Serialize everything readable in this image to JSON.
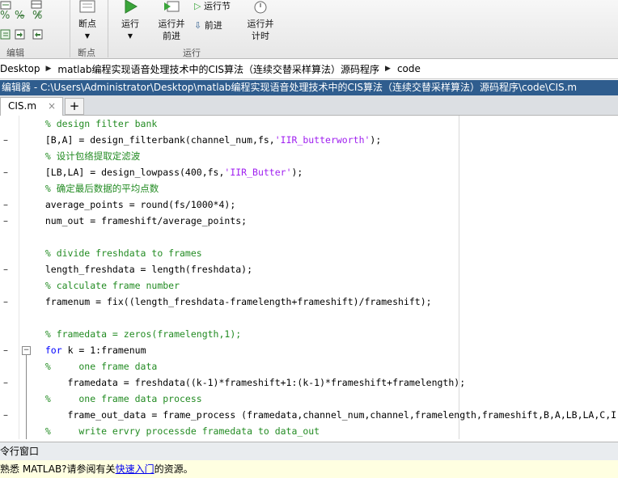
{
  "toolstrip": {
    "breakpoints_label": "断点",
    "run_label": "运行",
    "run_advance_label": "运行并\n前进",
    "run_section_label": "运行节",
    "advance_label": "前进",
    "run_time_label": "运行并\n计时",
    "group_edit": "编辑",
    "group_breakpoints": "断点",
    "group_run": "运行",
    "colors": {
      "run_green": "#3aa53a",
      "accent": "#2f5d8e"
    }
  },
  "breadcrumb": {
    "items": [
      "Desktop",
      "matlab编程实现语音处理技术中的CIS算法（连续交替采样算法）源码程序",
      "code"
    ]
  },
  "editor": {
    "title": "编辑器 - C:\\Users\\Administrator\\Desktop\\matlab编程实现语音处理技术中的CIS算法（连续交替采样算法）源码程序\\code\\CIS.m",
    "tab_label": "CIS.m",
    "tab_close": "×",
    "new_tab": "+",
    "lines": [
      {
        "dash": "",
        "parts": [
          {
            "t": "  % design filter bank",
            "c": "cm"
          }
        ]
      },
      {
        "dash": "–",
        "parts": [
          {
            "t": "  [B,A] = design_filterbank(channel_num,fs,",
            "c": ""
          },
          {
            "t": "'IIR_butterworth'",
            "c": "st"
          },
          {
            "t": ");",
            "c": ""
          }
        ]
      },
      {
        "dash": "",
        "parts": [
          {
            "t": "  % 设计包络提取定滤波",
            "c": "cm"
          }
        ]
      },
      {
        "dash": "–",
        "parts": [
          {
            "t": "  [LB,LA] = design_lowpass(400,fs,",
            "c": ""
          },
          {
            "t": "'IIR_Butter'",
            "c": "st"
          },
          {
            "t": ");",
            "c": ""
          }
        ]
      },
      {
        "dash": "",
        "parts": [
          {
            "t": "  % 确定最后数据的平均点数",
            "c": "cm"
          }
        ]
      },
      {
        "dash": "–",
        "parts": [
          {
            "t": "  average_points = round(fs/1000*4);",
            "c": ""
          }
        ]
      },
      {
        "dash": "–",
        "parts": [
          {
            "t": "  num_out = frameshift/average_points;",
            "c": ""
          }
        ]
      },
      {
        "dash": "",
        "parts": [
          {
            "t": "",
            "c": ""
          }
        ]
      },
      {
        "dash": "",
        "parts": [
          {
            "t": "  % divide freshdata to frames",
            "c": "cm"
          }
        ]
      },
      {
        "dash": "–",
        "parts": [
          {
            "t": "  length_freshdata = length(freshdata);",
            "c": ""
          }
        ]
      },
      {
        "dash": "",
        "parts": [
          {
            "t": "  % calculate frame number",
            "c": "cm"
          }
        ]
      },
      {
        "dash": "–",
        "parts": [
          {
            "t": "  framenum = fix((length_freshdata-framelength+frameshift)/frameshift);",
            "c": ""
          }
        ]
      },
      {
        "dash": "",
        "parts": [
          {
            "t": "",
            "c": ""
          }
        ]
      },
      {
        "dash": "",
        "parts": [
          {
            "t": "  % framedata = zeros(framelength,1);",
            "c": "cm"
          }
        ]
      },
      {
        "dash": "–",
        "parts": [
          {
            "t": "  ",
            "c": ""
          },
          {
            "t": "for",
            "c": "kw"
          },
          {
            "t": " k = 1:framenum",
            "c": ""
          }
        ]
      },
      {
        "dash": "",
        "parts": [
          {
            "t": "  %     one frame data",
            "c": "cm"
          }
        ]
      },
      {
        "dash": "–",
        "parts": [
          {
            "t": "      framedata = freshdata((k-1)*frameshift+1:(k-1)*frameshift+framelength);",
            "c": ""
          }
        ]
      },
      {
        "dash": "",
        "parts": [
          {
            "t": "  %     one frame data process",
            "c": "cm"
          }
        ]
      },
      {
        "dash": "–",
        "parts": [
          {
            "t": "      frame_out_data = frame_process (framedata,channel_num,channel,framelength,frameshift,B,A,LB,LA,C,I,T",
            "c": ""
          }
        ]
      },
      {
        "dash": "",
        "parts": [
          {
            "t": "  %     write ervry processde framedata to data_out",
            "c": "cm"
          }
        ]
      }
    ]
  },
  "command_window": {
    "title": "令行窗口",
    "info_prefix": "熟悉 MATLAB?请参阅有关",
    "info_link": "快速入门",
    "info_suffix": "的资源。"
  }
}
